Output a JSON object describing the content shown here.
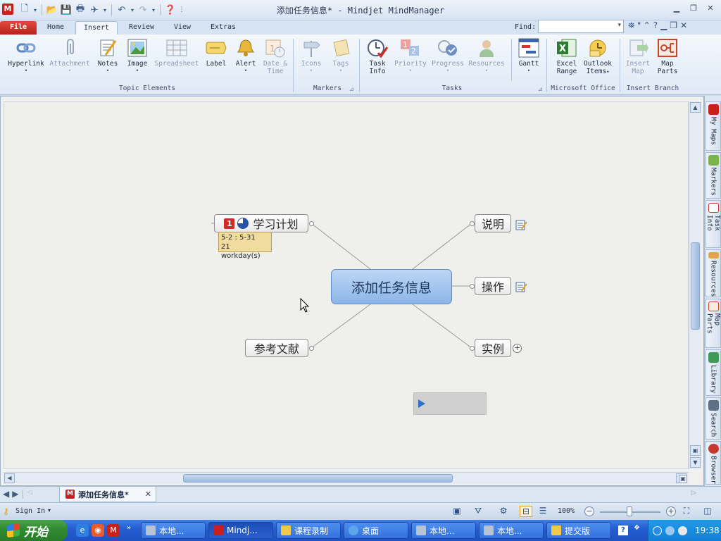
{
  "window": {
    "title": "添加任务信息* - Mindjet MindManager",
    "logo": "M"
  },
  "ribbon_tabs": [
    "File",
    "Home",
    "Insert",
    "Review",
    "View",
    "Extras"
  ],
  "active_tab": "Insert",
  "find": {
    "label": "Find:",
    "value": ""
  },
  "ribbon": {
    "buttons": {
      "hyperlink": "Hyperlink",
      "attachment": "Attachment",
      "notes": "Notes",
      "image": "Image",
      "spreadsheet": "Spreadsheet",
      "label": "Label",
      "alert": "Alert",
      "date_time_1": "Date &",
      "date_time_2": "Time",
      "icons": "Icons",
      "tags": "Tags",
      "task_info_1": "Task",
      "task_info_2": "Info",
      "priority": "Priority",
      "progress": "Progress",
      "resources": "Resources",
      "gantt": "Gantt",
      "excel_1": "Excel",
      "excel_2": "Range",
      "outlook_1": "Outlook",
      "outlook_2": "Items",
      "insert_map_1": "Insert",
      "insert_map_2": "Map",
      "map_parts_1": "Map",
      "map_parts_2": "Parts"
    },
    "groups": {
      "topic_elements": "Topic Elements",
      "markers": "Markers",
      "tasks": "Tasks",
      "microsoft_office": "Microsoft Office",
      "insert_branch": "Insert Branch"
    }
  },
  "map": {
    "central_topic": "添加任务信息",
    "topics": {
      "study_plan": "学习计划",
      "references": "参考文献",
      "description": "说明",
      "operation": "操作",
      "example": "实例"
    },
    "task_info": {
      "dates": "5-2 : 5-31",
      "duration": "21 workday(s)"
    },
    "priority_badge": "1",
    "progress_percent": 75
  },
  "sidebar": [
    "My Maps",
    "Markers",
    "Task Info",
    "Resources",
    "Map Parts",
    "Library",
    "Search",
    "Browser"
  ],
  "document_tab": "添加任务信息*",
  "statusbar": {
    "sign_in": "Sign In",
    "zoom": "100%"
  },
  "taskbar": {
    "start": "开始",
    "buttons": [
      "本地...",
      "Mindj...",
      "课程录制",
      "桌面",
      "本地...",
      "本地...",
      "提交版"
    ],
    "clock": "19:38"
  }
}
